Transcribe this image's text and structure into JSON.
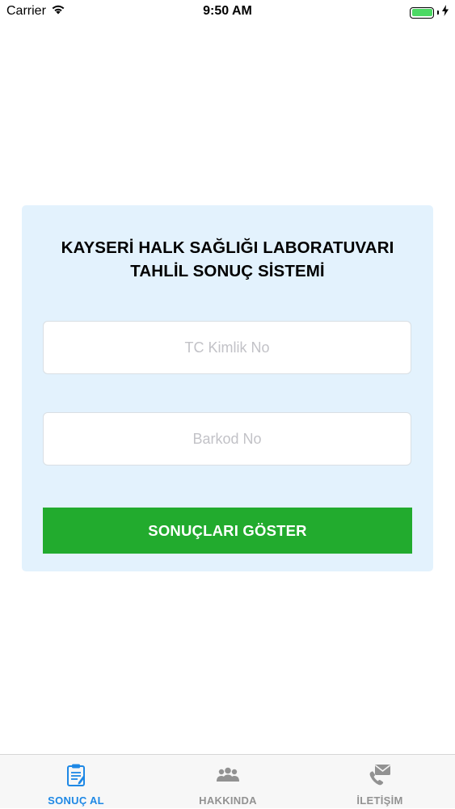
{
  "status_bar": {
    "carrier": "Carrier",
    "time": "9:50 AM",
    "battery_level": 1.0
  },
  "card": {
    "title_line1": "KAYSERİ HALK SAĞLIĞI LABORATUVARI",
    "title_line2": "TAHLİL SONUÇ SİSTEMİ",
    "tc_placeholder": "TC Kimlik No",
    "tc_value": "",
    "barkod_placeholder": "Barkod No",
    "barkod_value": "",
    "submit_label": "SONUÇLARI GÖSTER"
  },
  "tabs": [
    {
      "label": "SONUÇ AL",
      "icon": "clipboard-icon",
      "active": true
    },
    {
      "label": "HAKKINDA",
      "icon": "people-icon",
      "active": false
    },
    {
      "label": "İLETİŞİM",
      "icon": "phone-mail-icon",
      "active": false
    }
  ],
  "colors": {
    "card_bg": "#e3f2fd",
    "button_green": "#22ab2e",
    "tab_active": "#1e88e5",
    "tab_inactive": "#929292"
  }
}
